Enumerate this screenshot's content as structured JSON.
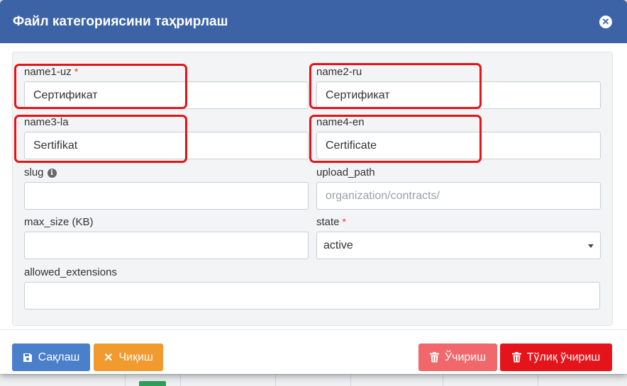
{
  "modal": {
    "title": "Файл категориясини таҳрирлаш",
    "close_icon": "close-circle-icon"
  },
  "form": {
    "name1_uz": {
      "label": "name1-uz",
      "required": "*",
      "value": "Сертификат"
    },
    "name2_ru": {
      "label": "name2-ru",
      "value": "Сертификат"
    },
    "name3_la": {
      "label": "name3-la",
      "value": "Sertifikat"
    },
    "name4_en": {
      "label": "name4-en",
      "value": "Certificate"
    },
    "slug": {
      "label": "slug",
      "info_icon": "info-circle-icon",
      "info_glyph": "i",
      "value": ""
    },
    "upload_path": {
      "label": "upload_path",
      "value": "",
      "placeholder": "organization/contracts/"
    },
    "max_size": {
      "label": "max_size (KB)",
      "value": ""
    },
    "state": {
      "label": "state",
      "required": "*",
      "selected": "active"
    },
    "allowed_extensions": {
      "label": "allowed_extensions",
      "value": ""
    }
  },
  "footer": {
    "save_label": "Сақлаш",
    "exit_label": "Чиқиш",
    "delete_label": "Ўчириш",
    "full_delete_label": "Тўлиқ ўчириш"
  },
  "colors": {
    "header": "#3b63a6",
    "highlight": "#e5141b",
    "save": "#4a7fca",
    "exit": "#f19a2e",
    "delete": "#f0686c",
    "full_delete": "#e5141b"
  }
}
